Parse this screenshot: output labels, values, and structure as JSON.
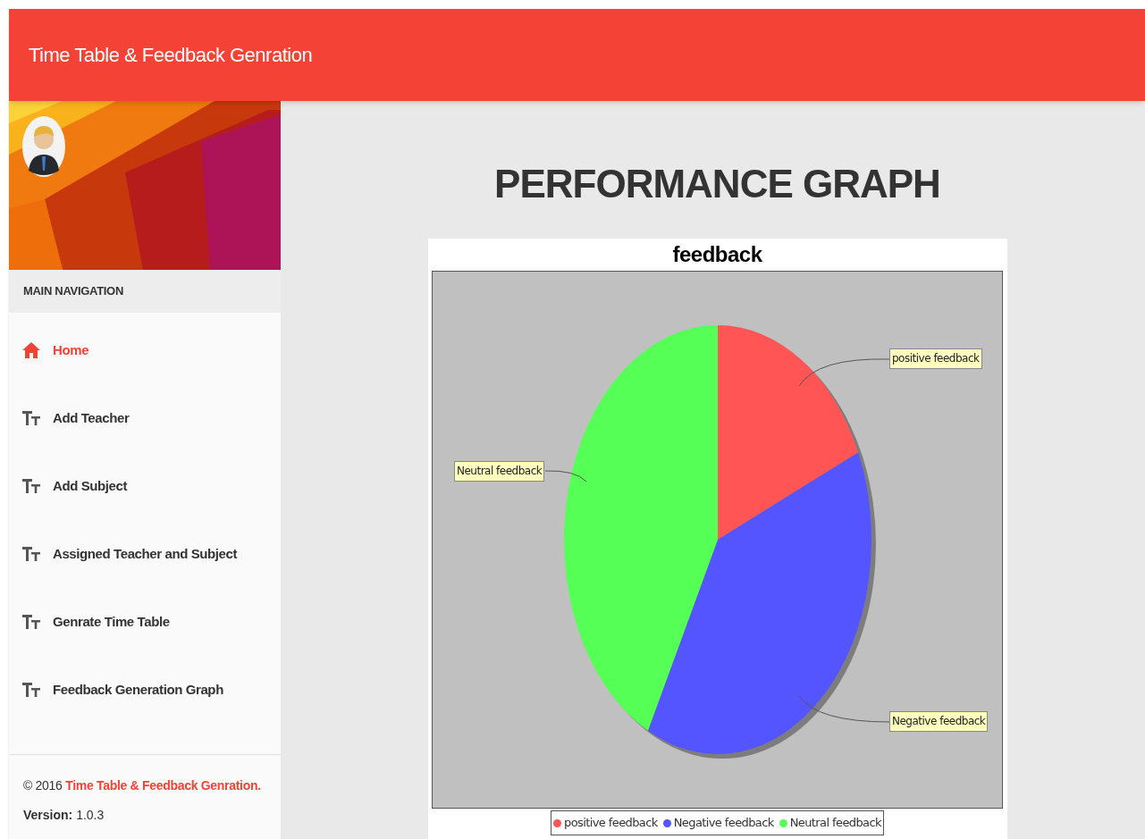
{
  "header": {
    "title": "Time Table & Feedback Genration"
  },
  "sidebar": {
    "section_label": "MAIN NAVIGATION",
    "items": [
      {
        "kind": "home",
        "label": "Home",
        "selected": true
      },
      {
        "kind": "text",
        "label": "Add Teacher",
        "selected": false
      },
      {
        "kind": "text",
        "label": "Add Subject",
        "selected": false
      },
      {
        "kind": "text",
        "label": "Assigned Teacher and Subject",
        "selected": false
      },
      {
        "kind": "text",
        "label": "Genrate Time Table",
        "selected": false
      },
      {
        "kind": "text",
        "label": "Feedback Generation Graph",
        "selected": false
      }
    ],
    "footer": {
      "copyright_prefix": "© 2016",
      "copyright_link": "Time Table & Feedback Genration.",
      "version_label": "Version:",
      "version": "1.0.3"
    }
  },
  "main": {
    "heading": "PERFORMANCE GRAPH",
    "chart": {
      "title": "feedback",
      "slices": [
        {
          "label": "positive feedback",
          "color": "#ff5555"
        },
        {
          "label": "Negative feedback",
          "color": "#5555ff"
        },
        {
          "label": "Neutral feedback",
          "color": "#55ff55"
        }
      ],
      "legend": [
        {
          "label": "positive feedback",
          "color": "#ff5555"
        },
        {
          "label": "Negative feedback",
          "color": "#5555ff"
        },
        {
          "label": "Neutral feedback",
          "color": "#55ff55"
        }
      ]
    }
  }
}
